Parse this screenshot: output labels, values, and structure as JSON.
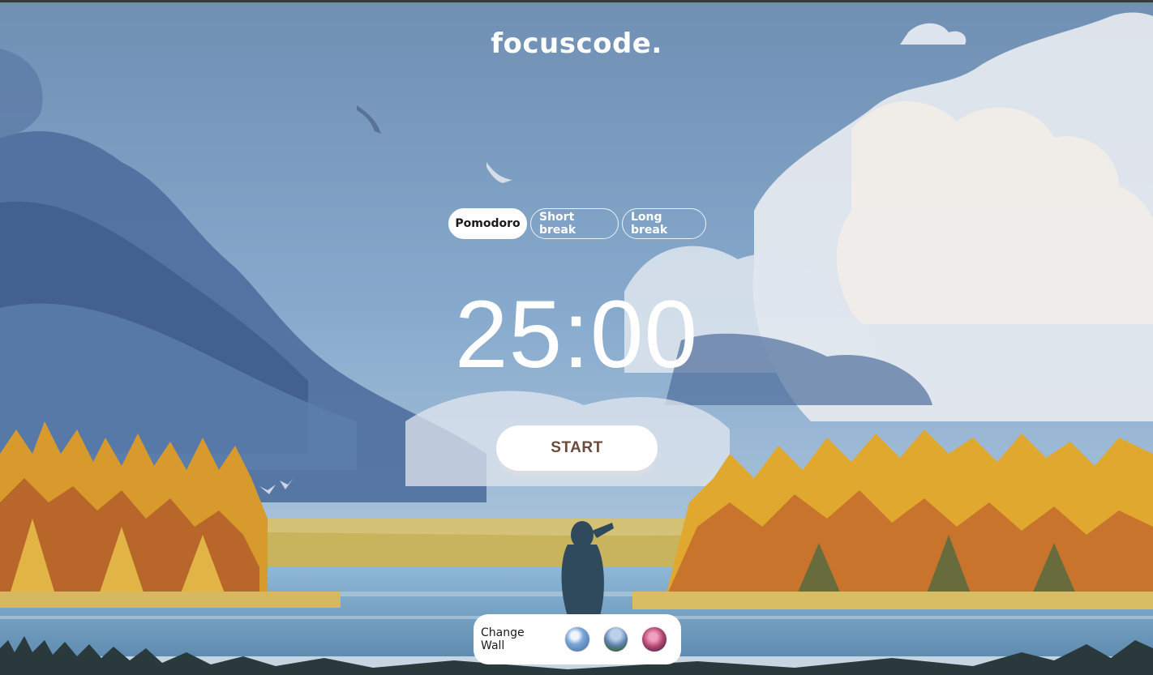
{
  "app": {
    "logo": "focuscode."
  },
  "modes": [
    {
      "label": "Pomodoro",
      "active": true
    },
    {
      "label": "Short break",
      "active": false
    },
    {
      "label": "Long break",
      "active": false
    }
  ],
  "timer": {
    "display": "25:00"
  },
  "controls": {
    "start_label": "START"
  },
  "wallpaper_picker": {
    "label": "Change Wall",
    "options": [
      {
        "name": "sky-lake-wallpaper"
      },
      {
        "name": "mountain-clouds-wallpaper"
      },
      {
        "name": "pink-sunset-wallpaper"
      }
    ]
  },
  "colors": {
    "accent_text": "#6b4a3e",
    "primary": "#ffffff"
  }
}
